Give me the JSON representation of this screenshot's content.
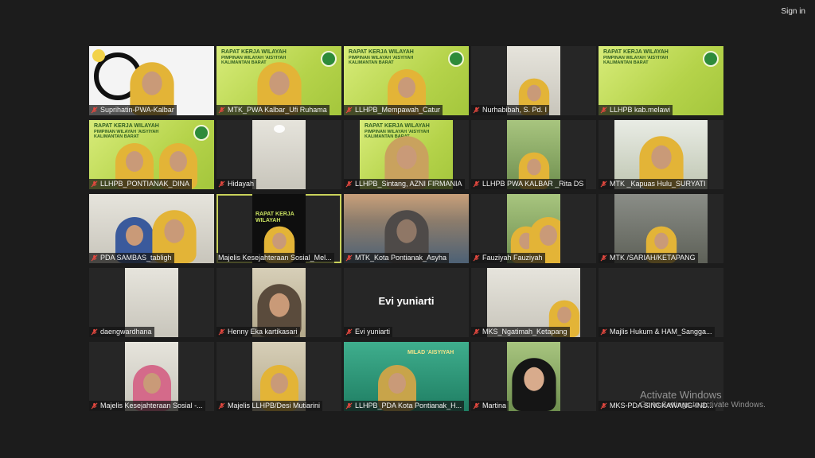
{
  "header": {
    "sign_in_label": "Sign in"
  },
  "activation": {
    "title": "Activate Windows",
    "subtitle": "Go to Settings to activate Windows."
  },
  "tiles": [
    {
      "name": "Suprihatin-PWA-Kalbar"
    },
    {
      "name": "MTK_PWA Kalbar_Ufi Ruhama"
    },
    {
      "name": "LLHPB_Mempawah_Catur"
    },
    {
      "name": "Nurhabibah, S. Pd. I"
    },
    {
      "name": "LLHPB kab.melawi"
    },
    {
      "name": "LLHPB_PONTIANAK_DINA"
    },
    {
      "name": "Hidayah"
    },
    {
      "name": "LLHPB_Sintang, AZNI FIRMANIA"
    },
    {
      "name": "LLHPB PWA KALBAR _Rita DS"
    },
    {
      "name": "MTK _Kapuas Hulu_SURYATI"
    },
    {
      "name": "PDA SAMBAS_tabligh"
    },
    {
      "name": "Majelis Kesejahteraan Sosial_Mel..."
    },
    {
      "name": "MTK_Kota Pontianak_Asyha"
    },
    {
      "name": "Fauziyah Fauziyah"
    },
    {
      "name": "MTK /SARIAH/KETAPANG"
    },
    {
      "name": "daengwardhana"
    },
    {
      "name": "Henny Eka kartikasari"
    },
    {
      "name": "Evi yuniarti",
      "display_name": "Evi yuniarti"
    },
    {
      "name": "MKS_Ngatimah_Ketapang"
    },
    {
      "name": "Majlis Hukum & HAM_Sangga..."
    },
    {
      "name": "Majelis Kesejahteraan Sosial -..."
    },
    {
      "name": "Majelis LLHPB/Desi Mutiarini"
    },
    {
      "name": "LLHPB_PDA Kota Pontianak_H..."
    },
    {
      "name": "Martina"
    },
    {
      "name": "MKS-PDA SINGKAWANG-IND..."
    }
  ],
  "banner": {
    "line1": "RAPAT KERJA WILAYAH",
    "line2": "PIMPINAN WILAYAH 'AISYIYAH",
    "line3": "KALIMANTAN BARAT"
  },
  "milad": {
    "line1": "MILAD 'AISYIYAH"
  },
  "colors": {
    "background": "#1c1c1c",
    "tile": "#262626",
    "active_outline": "#c9d25a",
    "banner": "#c8e060",
    "muted_mic": "#e5483f"
  }
}
